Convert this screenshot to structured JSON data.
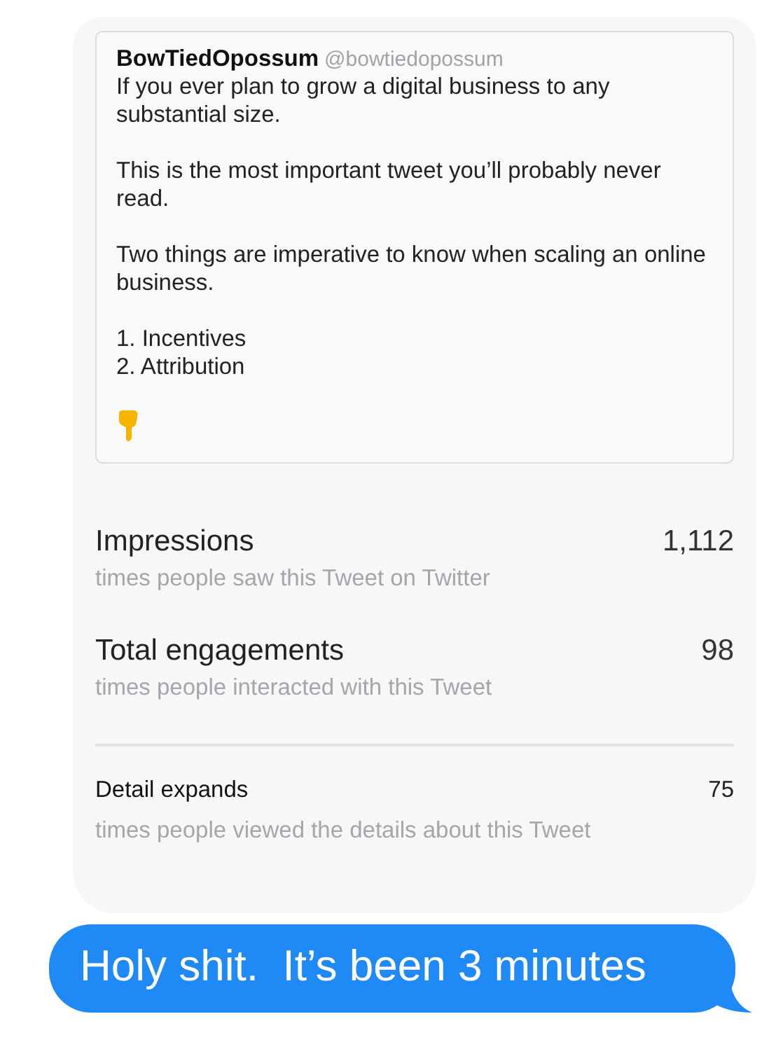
{
  "tweet": {
    "name": "BowTiedOpossum",
    "handle": "@bowtiedopossum",
    "paragraphs": [
      "If you ever plan to grow a digital business to any substantial size.",
      "This is the most important tweet you’ll probably never read.",
      "Two things are imperative to know when scaling an online business.",
      "1. Incentives\n2. Attribution"
    ]
  },
  "metrics": [
    {
      "kind": "primary",
      "label": "Impressions",
      "value": "1,112",
      "description": "times people saw this Tweet on Twitter"
    },
    {
      "kind": "primary",
      "label": "Total engagements",
      "value": "98",
      "description": "times people interacted with this Tweet"
    },
    {
      "kind": "secondary",
      "label": "Detail expands",
      "value": "75",
      "description": "times people viewed the details about this Tweet"
    }
  ],
  "message": {
    "text": "Holy shit.  It’s been 3 minutes"
  }
}
